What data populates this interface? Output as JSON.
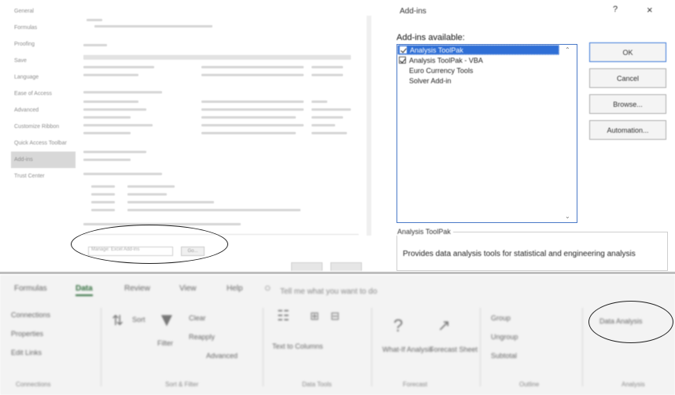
{
  "options_panel": {
    "nav_items": [
      "General",
      "Formulas",
      "Proofing",
      "Save",
      "Language",
      "Ease of Access",
      "Advanced",
      "Customize Ribbon",
      "Quick Access Toolbar",
      "Add-ins",
      "Trust Center"
    ],
    "active_nav": "Add-ins",
    "manage_label": "Manage: Excel Add-ins",
    "go_label": "Go..."
  },
  "addins_dialog": {
    "title": "Add-ins",
    "help_glyph": "?",
    "close_glyph": "×",
    "available_label": "Add-ins available:",
    "items": [
      {
        "label": "Analysis ToolPak",
        "checked": true,
        "selected": true
      },
      {
        "label": "Analysis ToolPak - VBA",
        "checked": true,
        "selected": false
      },
      {
        "label": "Euro Currency Tools",
        "checked": false,
        "selected": false
      },
      {
        "label": "Solver Add-in",
        "checked": false,
        "selected": false
      }
    ],
    "buttons": {
      "ok": "OK",
      "cancel": "Cancel",
      "browse": "Browse...",
      "automation": "Automation..."
    },
    "description_title": "Analysis ToolPak",
    "description_text": "Provides data analysis tools for statistical and engineering analysis"
  },
  "ribbon": {
    "tabs": [
      "Formulas",
      "Data",
      "Review",
      "View",
      "Help"
    ],
    "active_tab": "Data",
    "tell_me": "Tell me what you want to do",
    "items": {
      "connections": "Connections",
      "properties": "Properties",
      "edit_links": "Edit Links",
      "sort": "Sort",
      "filter": "Filter",
      "clear": "Clear",
      "reapply": "Reapply",
      "advanced": "Advanced",
      "text_to_columns": "Text to Columns",
      "what_if": "What-If Analysis",
      "forecast_sheet": "Forecast Sheet",
      "group": "Group",
      "ungroup": "Ungroup",
      "subtotal": "Subtotal",
      "data_analysis": "Data Analysis"
    },
    "groups": [
      "Connections",
      "Sort & Filter",
      "Data Tools",
      "Forecast",
      "Outline",
      "Analysis"
    ]
  }
}
